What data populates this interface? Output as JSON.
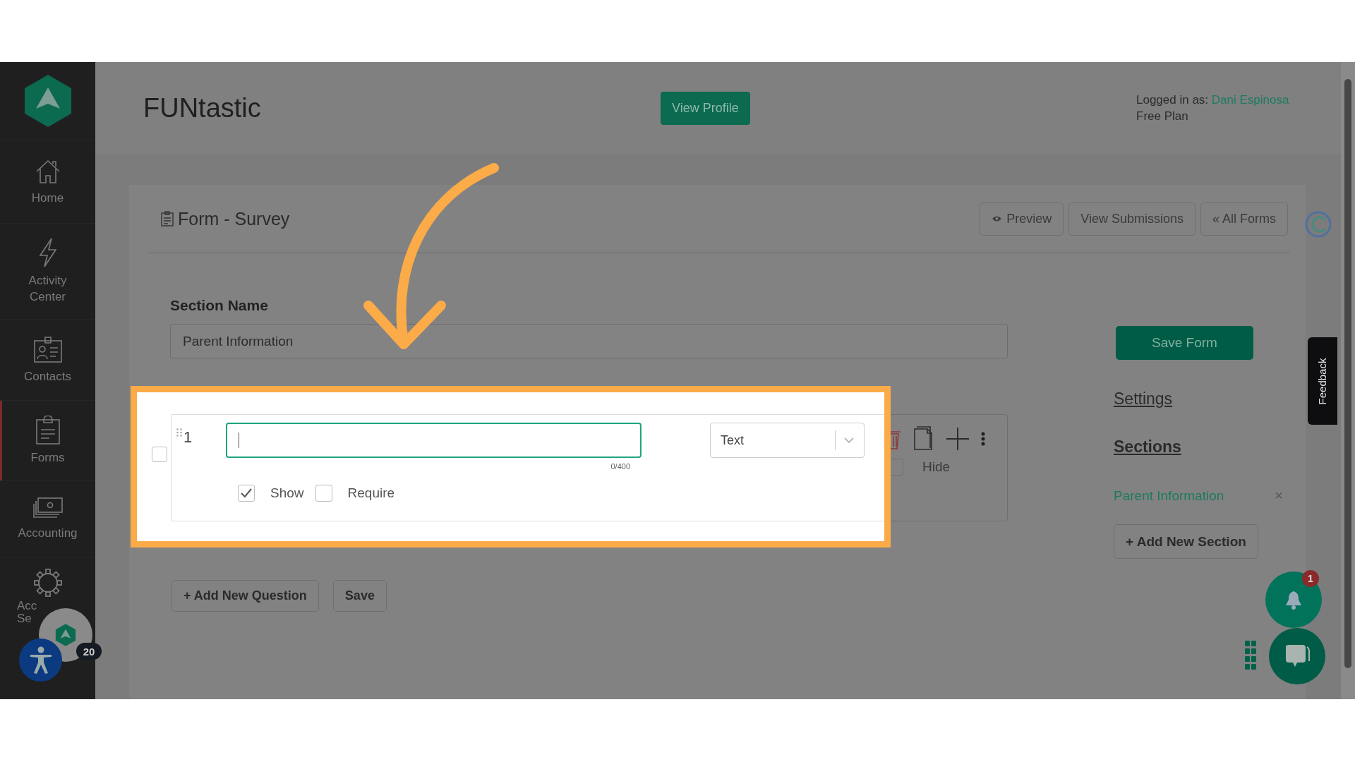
{
  "header": {
    "title": "FUNtastic",
    "view_profile": "View Profile",
    "logged_in_label": "Logged in as:",
    "user_name": "Dani Espinosa",
    "plan": "Free Plan"
  },
  "sidebar": {
    "items": [
      {
        "kind": "home",
        "lines": [
          "Home"
        ],
        "selected": false
      },
      {
        "kind": "activity",
        "lines": [
          "Activity",
          "Center"
        ],
        "selected": false
      },
      {
        "kind": "contacts",
        "lines": [
          "Contacts"
        ],
        "selected": false
      },
      {
        "kind": "forms",
        "lines": [
          "Forms"
        ],
        "selected": true
      },
      {
        "kind": "accounting",
        "lines": [
          "Accounting"
        ],
        "selected": false
      },
      {
        "kind": "settings",
        "lines": [
          "Acc",
          "Se"
        ],
        "selected": false
      }
    ]
  },
  "form": {
    "title": "Form - Survey",
    "actions": [
      {
        "kind": "preview",
        "label": "Preview"
      },
      {
        "kind": "plain",
        "label": "View Submissions"
      },
      {
        "kind": "plain",
        "label": "« All Forms"
      }
    ]
  },
  "section_name": {
    "label": "Section Name",
    "value": "Parent Information"
  },
  "question": {
    "selected": false,
    "number": "1",
    "counter": "0/400",
    "type": "Text",
    "show": {
      "label": "Show",
      "checked": true
    },
    "require": {
      "label": "Require",
      "checked": false
    },
    "hide": {
      "label": "Hide",
      "checked": false
    }
  },
  "buttons": [
    "+ Add New Question",
    "Save"
  ],
  "side_panel": {
    "save": "Save Form",
    "settings": "Settings",
    "sections_title": "Sections",
    "sections": [
      {
        "label": "Parent Information",
        "close": "×"
      }
    ],
    "add_section": "+ Add New Section"
  },
  "feedback": "Feedback",
  "notification_count": "1",
  "avatar_badge": "20"
}
